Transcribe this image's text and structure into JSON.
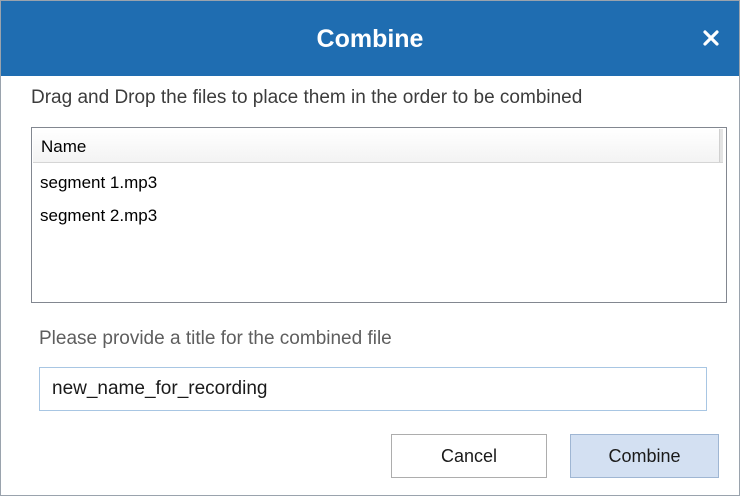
{
  "dialog": {
    "title": "Combine",
    "close_glyph": "×",
    "close_icon": "close-icon",
    "accent_color": "#1f6db1"
  },
  "instructions": "Drag and Drop the files to place them in the order to be combined",
  "file_list": {
    "column_header": "Name",
    "rows": [
      "segment 1.mp3",
      "segment 2.mp3"
    ]
  },
  "title_prompt": "Please provide a title for the combined file",
  "title_input": {
    "value": "new_name_for_recording"
  },
  "buttons": {
    "cancel_label": "Cancel",
    "combine_label": "Combine"
  }
}
